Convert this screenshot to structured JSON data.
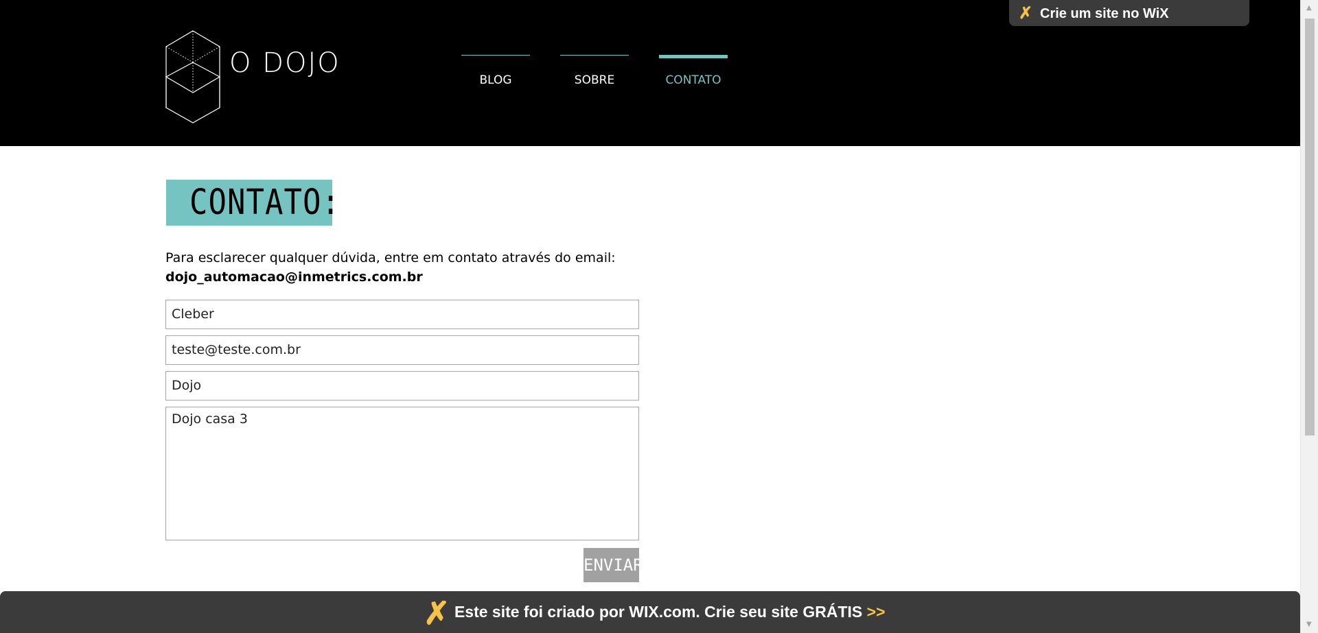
{
  "header": {
    "logo_text": "O DOJO",
    "nav": [
      {
        "label": "BLOG",
        "active": false
      },
      {
        "label": "SOBRE",
        "active": false
      },
      {
        "label": "CONTATO",
        "active": true
      }
    ],
    "wix_promo": "Crie um site no WiX"
  },
  "main": {
    "title": "CONTATO:",
    "description": "Para esclarecer qualquer dúvida, entre em contato através do email:",
    "email": "dojo_automacao@inmetrics.com.br",
    "form": {
      "name": "Cleber",
      "email": "teste@teste.com.br",
      "subject": "Dojo",
      "message": "Dojo casa 3",
      "submit_label": "ENVIAR"
    }
  },
  "footer": {
    "banner_text": "Este site foi criado por WIX.com. Crie seu site GRÁTIS",
    "arrows": ">>"
  },
  "colors": {
    "accent": "#76c4c2",
    "header_bg": "#000000",
    "wix_bar": "#3b3b3b",
    "wix_yellow": "#f6c344",
    "button_bg": "#a1a1a1"
  },
  "icons": [
    "dojo-cube-logo-icon",
    "wix-x-icon",
    "scroll-up-arrow-icon",
    "scroll-down-arrow-icon"
  ]
}
